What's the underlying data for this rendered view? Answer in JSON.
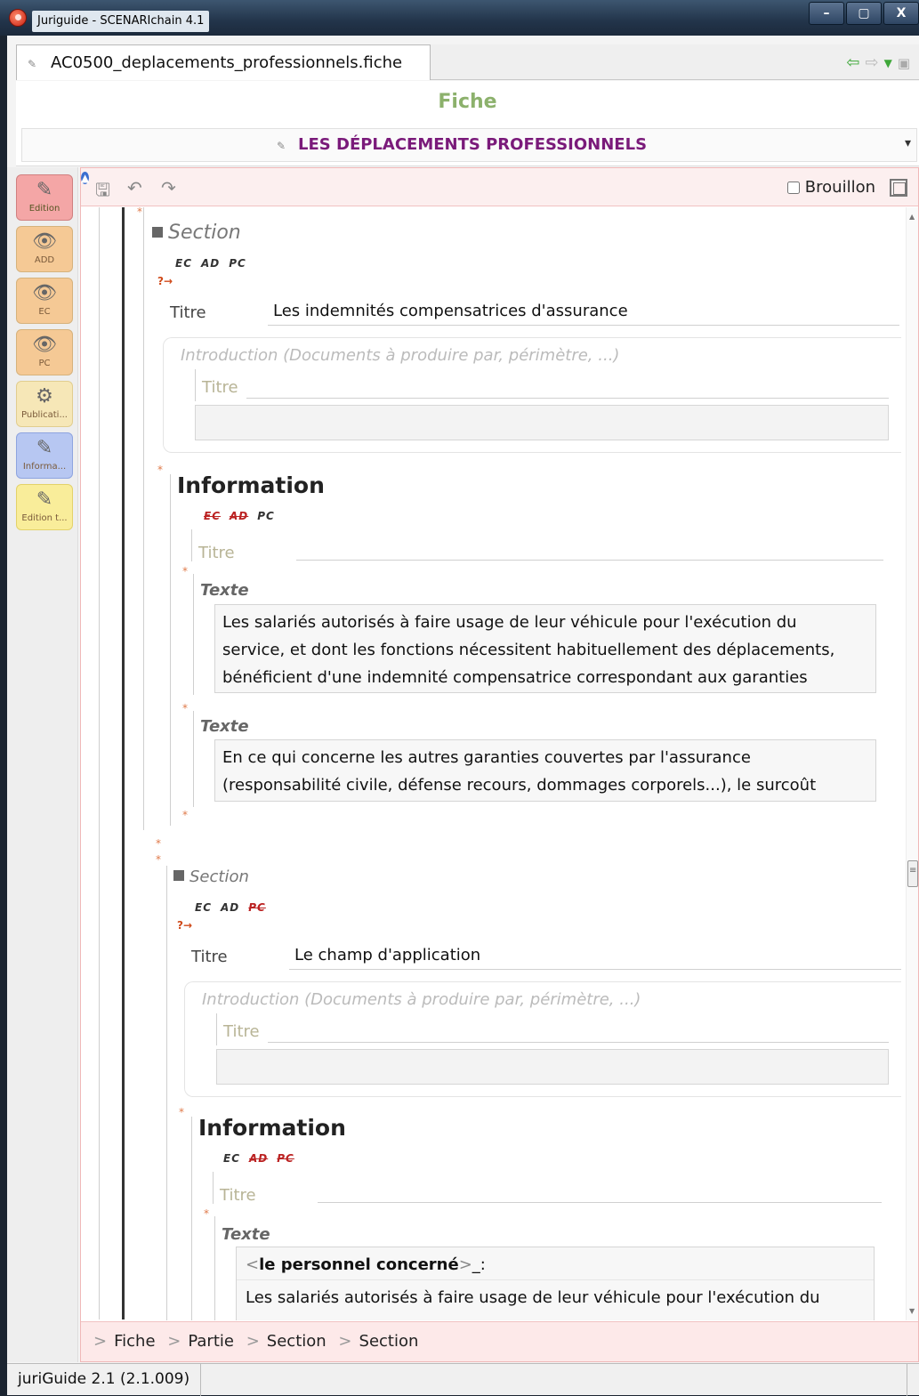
{
  "window": {
    "title": "Juriguide - SCENARIchain 4.1",
    "buttons": {
      "minimize": "–",
      "maximize": "▢",
      "close": "X"
    }
  },
  "tab": {
    "filename": "AC0500_deplacements_professionnels.fiche"
  },
  "header": {
    "model": "Fiche",
    "document_title": "LES DÉPLACEMENTS PROFESSIONNELS"
  },
  "modes": [
    {
      "label": "Edition",
      "icon": "pencil-icon"
    },
    {
      "label": "ADD",
      "icon": "eye-icon"
    },
    {
      "label": "EC",
      "icon": "eye-icon"
    },
    {
      "label": "PC",
      "icon": "eye-icon"
    },
    {
      "label": "Publicati...",
      "icon": "publish-icon"
    },
    {
      "label": "Informa...",
      "icon": "info-icon"
    },
    {
      "label": "Edition t...",
      "icon": "pencil-icon"
    }
  ],
  "toolbar": {
    "brouillon_label": "Brouillon",
    "brouillon_checked": false
  },
  "content": {
    "section1": {
      "label": "Section",
      "badges": [
        "EC",
        "AD",
        "PC"
      ],
      "titre_label": "Titre",
      "titre_value": "Les indemnités compensatrices d'assurance",
      "intro_label": "Introduction (Documents à produire par, périmètre, ...)",
      "intro_titre_label": "Titre"
    },
    "info1": {
      "title": "Information",
      "badges": [
        "EC",
        "AD",
        "PC"
      ],
      "titre_label": "Titre",
      "texte1_label": "Texte",
      "texte1_lines": [
        "Les salariés autorisés à faire usage de leur véhicule pour l'exécution du",
        "service, et dont les fonctions nécessitent habituellement des déplacements,",
        "bénéficient d'une indemnité compensatrice correspondant aux garanties"
      ],
      "texte2_label": "Texte",
      "texte2_lines": [
        "En ce qui concerne les autres garanties couvertes par l'assurance",
        "(responsabilité civile, défense recours, dommages corporels...), le surcoût"
      ]
    },
    "section2": {
      "label": "Section",
      "badges": [
        "EC",
        "AD",
        "PC"
      ],
      "titre_label": "Titre",
      "titre_value": "Le champ d'application",
      "intro_label": "Introduction (Documents à produire par, périmètre, ...)",
      "intro_titre_label": "Titre"
    },
    "info2": {
      "title": "Information",
      "badges": [
        "EC",
        "AD",
        "PC"
      ],
      "titre_label": "Titre",
      "texte_label": "Texte",
      "line1_open": "<",
      "line1_bold": "le personnel concerné",
      "line1_close": ">",
      "line1_tail": "_:",
      "line2": "Les salariés autorisés à faire usage de leur véhicule pour l'exécution du"
    }
  },
  "breadcrumb": {
    "sep": ">",
    "items": [
      "Fiche",
      "Partie",
      "Section",
      "Section"
    ]
  },
  "status": {
    "version": "juriGuide 2.1 (2.1.009)"
  }
}
